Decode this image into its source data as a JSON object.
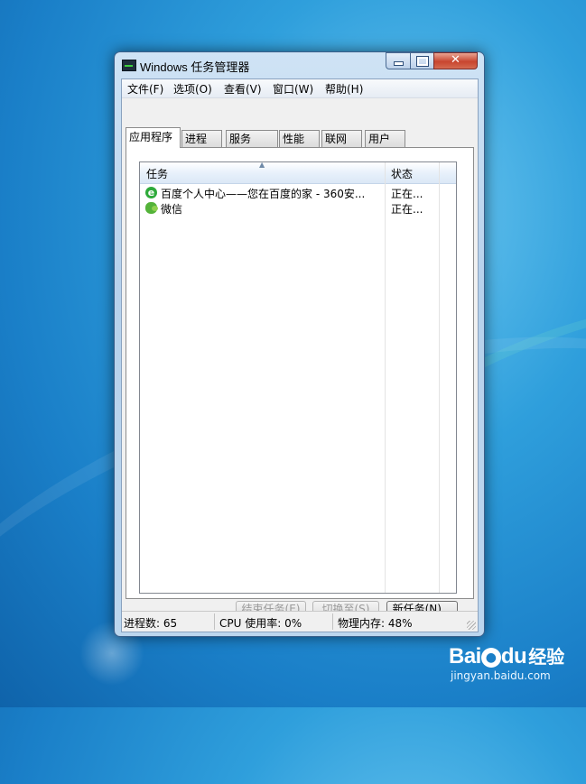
{
  "window": {
    "title": "Windows 任务管理器"
  },
  "menu": [
    "文件(F)",
    "选项(O)",
    "查看(V)",
    "窗口(W)",
    "帮助(H)"
  ],
  "tabs": [
    "应用程序",
    "进程",
    "服务",
    "性能",
    "联网",
    "用户"
  ],
  "list": {
    "columns": {
      "task": "任务",
      "status": "状态"
    },
    "rows": [
      {
        "name": "百度个人中心——您在百度的家 - 360安...",
        "status": "正在...",
        "icon": "ie-icon"
      },
      {
        "name": "微信",
        "status": "正在...",
        "icon": "wechat-icon"
      }
    ]
  },
  "buttons": {
    "end_task": "结束任务(E)",
    "switch_to": "切换至(S)",
    "new_task": "新任务(N)..."
  },
  "status": {
    "processes": "进程数: 65",
    "cpu": "CPU 使用率: 0%",
    "memory": "物理内存: 48%"
  },
  "watermark": {
    "logo": "Bai",
    "logo_suffix": "du",
    "jingyan": "经验",
    "url": "jingyan.baidu.com"
  }
}
